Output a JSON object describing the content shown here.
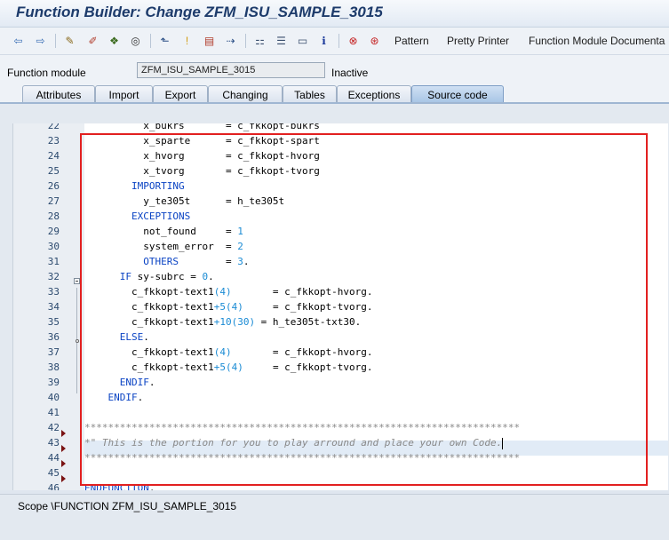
{
  "title": "Function Builder: Change ZFM_ISU_SAMPLE_3015",
  "toolbar": {
    "icons": [
      "back-arrow",
      "forward-arrow",
      "display-change-pencil",
      "other-object",
      "activate",
      "where-used",
      "navigate",
      "info",
      "display-object-list",
      "hierarchy",
      "toolbox",
      "layout",
      "help-info",
      "breakpoint",
      "external-breakpoint"
    ],
    "pattern_label": "Pattern",
    "pretty_printer_label": "Pretty Printer",
    "fm_doc_label": "Function Module Documenta"
  },
  "function_module": {
    "label": "Function module",
    "value": "ZFM_ISU_SAMPLE_3015",
    "status": "Inactive"
  },
  "tabs": [
    "Attributes",
    "Import",
    "Export",
    "Changing",
    "Tables",
    "Exceptions",
    "Source code"
  ],
  "active_tab": "Source code",
  "editor": {
    "lines": [
      {
        "no": "22",
        "tokens": [
          [
            "plain",
            "          x_bukrs       = c_fkkopt-bukrs"
          ]
        ]
      },
      {
        "no": "23",
        "tokens": [
          [
            "plain",
            "          x_sparte      = c_fkkopt-spart"
          ]
        ]
      },
      {
        "no": "24",
        "tokens": [
          [
            "plain",
            "          x_hvorg       = c_fkkopt-hvorg"
          ]
        ]
      },
      {
        "no": "25",
        "tokens": [
          [
            "plain",
            "          x_tvorg       = c_fkkopt-tvorg"
          ]
        ]
      },
      {
        "no": "26",
        "tokens": [
          [
            "kw",
            "        IMPORTING"
          ]
        ]
      },
      {
        "no": "27",
        "tokens": [
          [
            "plain",
            "          y_te305t      = h_te305t"
          ]
        ]
      },
      {
        "no": "28",
        "tokens": [
          [
            "kw",
            "        EXCEPTIONS"
          ]
        ]
      },
      {
        "no": "29",
        "tokens": [
          [
            "plain",
            "          not_found     = "
          ],
          [
            "num",
            "1"
          ]
        ]
      },
      {
        "no": "30",
        "tokens": [
          [
            "plain",
            "          system_error  = "
          ],
          [
            "num",
            "2"
          ]
        ]
      },
      {
        "no": "31",
        "tokens": [
          [
            "kw",
            "          OTHERS"
          ],
          [
            "plain",
            "        = "
          ],
          [
            "num",
            "3"
          ],
          [
            "plain",
            "."
          ]
        ]
      },
      {
        "no": "32",
        "tokens": [
          [
            "kw",
            "      IF"
          ],
          [
            "plain",
            " sy-subrc = "
          ],
          [
            "num",
            "0"
          ],
          [
            "plain",
            "."
          ]
        ]
      },
      {
        "no": "33",
        "tokens": [
          [
            "plain",
            "        c_fkkopt-text1"
          ],
          [
            "num",
            "(4)"
          ],
          [
            "plain",
            "       = c_fkkopt-hvorg."
          ]
        ]
      },
      {
        "no": "34",
        "tokens": [
          [
            "plain",
            "        c_fkkopt-text1"
          ],
          [
            "num",
            "+5(4)"
          ],
          [
            "plain",
            "     = c_fkkopt-tvorg."
          ]
        ]
      },
      {
        "no": "35",
        "tokens": [
          [
            "plain",
            "        c_fkkopt-text1"
          ],
          [
            "num",
            "+10(30)"
          ],
          [
            "plain",
            " = h_te305t-txt30."
          ]
        ]
      },
      {
        "no": "36",
        "tokens": [
          [
            "kw",
            "      ELSE"
          ],
          [
            "plain",
            "."
          ]
        ]
      },
      {
        "no": "37",
        "tokens": [
          [
            "plain",
            "        c_fkkopt-text1"
          ],
          [
            "num",
            "(4)"
          ],
          [
            "plain",
            "       = c_fkkopt-hvorg."
          ]
        ]
      },
      {
        "no": "38",
        "tokens": [
          [
            "plain",
            "        c_fkkopt-text1"
          ],
          [
            "num",
            "+5(4)"
          ],
          [
            "plain",
            "     = c_fkkopt-tvorg."
          ]
        ]
      },
      {
        "no": "39",
        "tokens": [
          [
            "kw",
            "      ENDIF"
          ],
          [
            "plain",
            "."
          ]
        ]
      },
      {
        "no": "40",
        "tokens": [
          [
            "kw",
            "    ENDIF"
          ],
          [
            "plain",
            "."
          ]
        ]
      },
      {
        "no": "41",
        "tokens": [
          [
            "plain",
            ""
          ]
        ]
      },
      {
        "no": "42",
        "tokens": [
          [
            "cmt",
            "**************************************************************************"
          ]
        ]
      },
      {
        "no": "43",
        "tokens": [
          [
            "cmt",
            "*\" This is the portion for you to play arround and place your own Code."
          ]
        ]
      },
      {
        "no": "44",
        "tokens": [
          [
            "cmt",
            "**************************************************************************"
          ]
        ]
      },
      {
        "no": "45",
        "tokens": [
          [
            "plain",
            ""
          ]
        ]
      },
      {
        "no": "46",
        "tokens": [
          [
            "kw",
            "ENDFUNCTION"
          ],
          [
            "plain",
            "."
          ]
        ]
      }
    ],
    "current_line": "43"
  },
  "scope": "Scope \\FUNCTION ZFM_ISU_SAMPLE_3015",
  "colors": {
    "title": "#1d3b6b",
    "keyword": "#0b44c4",
    "number": "#1a8bd4",
    "comment": "#888888",
    "line_number": "#2c4a6e",
    "highlight_box": "#e22020"
  }
}
